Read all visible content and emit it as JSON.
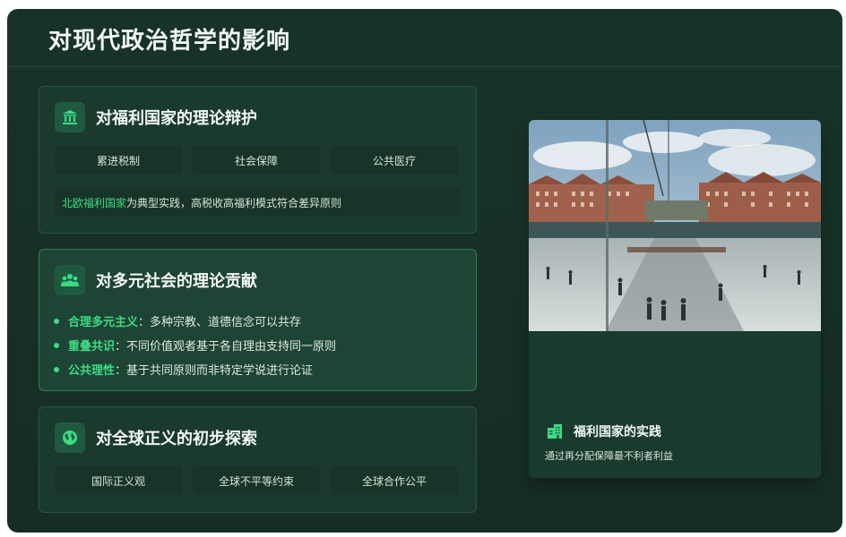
{
  "page": {
    "title": "对现代政治哲学的影响"
  },
  "cards": [
    {
      "title": "对福利国家的理论辩护",
      "icon": "bank-icon",
      "pills": [
        "累进税制",
        "社会保障",
        "公共医疗"
      ],
      "note": {
        "highlight": "北欧福利国家",
        "text": "为典型实践，高税收高福利模式符合差异原则"
      }
    },
    {
      "title": "对多元社会的理论贡献",
      "icon": "people-group-icon",
      "bullets": [
        {
          "term": "合理多元主义",
          "text": "：多种宗教、道德信念可以共存"
        },
        {
          "term": "重叠共识",
          "text": "：不同价值观者基于各自理由支持同一原则"
        },
        {
          "term": "公共理性",
          "text": "：基于共同原则而非特定学说进行论证"
        }
      ]
    },
    {
      "title": "对全球正义的初步探索",
      "icon": "globe-icon",
      "pills": [
        "国际正义观",
        "全球不平等约束",
        "全球合作公平"
      ]
    }
  ],
  "feature": {
    "icon": "building-icon",
    "title": "福利国家的实践",
    "subtitle": "通过再分配保障最不利者利益"
  },
  "colors": {
    "accent": "#3ddc84",
    "background": "#173328",
    "card": "#1b3a2e"
  }
}
